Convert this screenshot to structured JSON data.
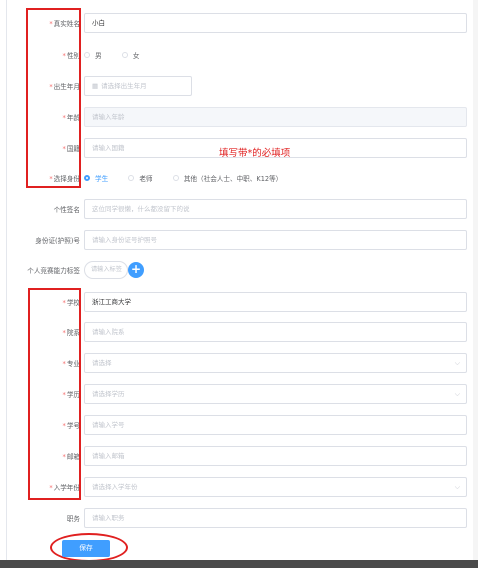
{
  "form": {
    "name": {
      "label": "真实姓名",
      "value": "小白"
    },
    "gender": {
      "label": "性别",
      "options": [
        "男",
        "女"
      ]
    },
    "birth": {
      "label": "出生年月",
      "placeholder": "请选择出生年月"
    },
    "age": {
      "label": "年龄",
      "placeholder": "请输入年龄"
    },
    "nationality": {
      "label": "国籍",
      "placeholder": "请输入国籍"
    },
    "identity": {
      "label": "选择身份",
      "options": [
        "学生",
        "老师",
        "其他（社会人士、中职、K12等）"
      ],
      "selected": "学生"
    },
    "signature": {
      "label": "个性签名",
      "placeholder": "这位同学很懒，什么都没留下的说"
    },
    "idcard": {
      "label": "身份证(护照)号",
      "placeholder": "请输入身份证号护照号"
    },
    "tags": {
      "label": "个人竞赛能力标签",
      "placeholder": "请输入标签"
    },
    "school": {
      "label": "学校",
      "value": "浙江工商大学"
    },
    "department": {
      "label": "院系",
      "placeholder": "请输入院系"
    },
    "major": {
      "label": "专业",
      "placeholder": "请选择"
    },
    "degree": {
      "label": "学历",
      "placeholder": "请选择学历"
    },
    "student_id": {
      "label": "学号",
      "placeholder": "请输入学号"
    },
    "email": {
      "label": "邮箱",
      "placeholder": "请输入邮箱"
    },
    "enroll_year": {
      "label": "入学年份",
      "placeholder": "请选择入学年份"
    },
    "position": {
      "label": "职务",
      "placeholder": "请输入职务"
    },
    "required_mark": "*",
    "save_label": "保存"
  },
  "annotation": {
    "text": "填写带*的必填项",
    "color": "#e02020"
  },
  "colors": {
    "primary": "#409eff",
    "required": "#f56c6c",
    "annotation": "#e02020"
  }
}
